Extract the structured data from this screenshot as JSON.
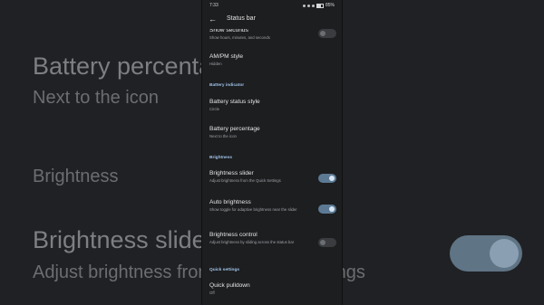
{
  "background": {
    "battery_percentage": "Battery percentage",
    "battery_percentage_value": "Next to the icon",
    "brightness_header": "Brightness",
    "brightness_slider": "Brightness slider",
    "brightness_slider_desc": "Adjust brightness from the Quick Settings"
  },
  "status_bar": {
    "time": "7:33",
    "battery": "85%"
  },
  "app_bar": {
    "title": "Status bar",
    "back_icon": "arrow-back-icon"
  },
  "items": [
    {
      "title": "Show seconds",
      "subtitle": "Show hours, minutes, and seconds",
      "toggle": "off"
    },
    {
      "title": "AM/PM style",
      "subtitle": "Hidden"
    }
  ],
  "sections": {
    "battery": "Battery indicator",
    "brightness": "Brightness",
    "quick": "Quick settings"
  },
  "battery_items": [
    {
      "title": "Battery status style",
      "subtitle": "Circle"
    },
    {
      "title": "Battery percentage",
      "subtitle": "Next to the icon"
    }
  ],
  "brightness_items": [
    {
      "title": "Brightness slider",
      "subtitle": "Adjust brightness from the Quick Settings",
      "toggle": "on"
    },
    {
      "title": "Auto brightness",
      "subtitle": "Show toggle for adaptive brightness near the slider",
      "toggle": "on"
    },
    {
      "title": "Brightness control",
      "subtitle": "Adjust brightness by sliding across the status bar",
      "toggle": "off"
    }
  ],
  "quick_items": [
    {
      "title": "Quick pulldown",
      "subtitle": "Off"
    }
  ],
  "colors": {
    "accent": "#9fc2e8",
    "toggle_on": "#5c7a94",
    "background": "#1d1e20"
  }
}
